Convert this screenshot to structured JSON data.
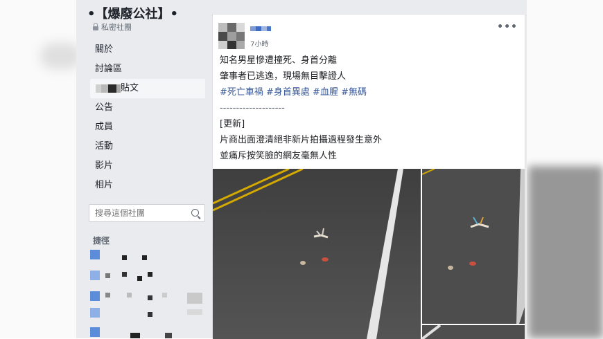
{
  "group": {
    "name": "【爆廢公社】",
    "privacy": "私密社團"
  },
  "nav": {
    "items": [
      {
        "label": "關於"
      },
      {
        "label": "討論區"
      },
      {
        "label": "貼文",
        "active": true
      },
      {
        "label": "公告"
      },
      {
        "label": "成員"
      },
      {
        "label": "活動"
      },
      {
        "label": "影片"
      },
      {
        "label": "相片"
      }
    ]
  },
  "search": {
    "placeholder": "搜尋這個社團"
  },
  "shortcuts": {
    "title": "捷徑"
  },
  "post": {
    "time": "7小時",
    "more": "•••",
    "lines": [
      "知名男星慘遭撞死、身首分離",
      "肇事者已逃逸，現場無目擊證人"
    ],
    "hashtags": "#死亡車禍 #身首異處 #血腥 #無碼",
    "divider": "--------------------",
    "update_tag": "[更新]",
    "update_lines": [
      "片商出面澄清絕非新片拍攝過程發生意外",
      "並痛斥按笑臉的網友毫無人性"
    ]
  },
  "colors": {
    "accent": "#385898",
    "sidebar_bg": "#e9ebee",
    "road": "#4a4a4a",
    "road_yellow": "#e0b400"
  }
}
